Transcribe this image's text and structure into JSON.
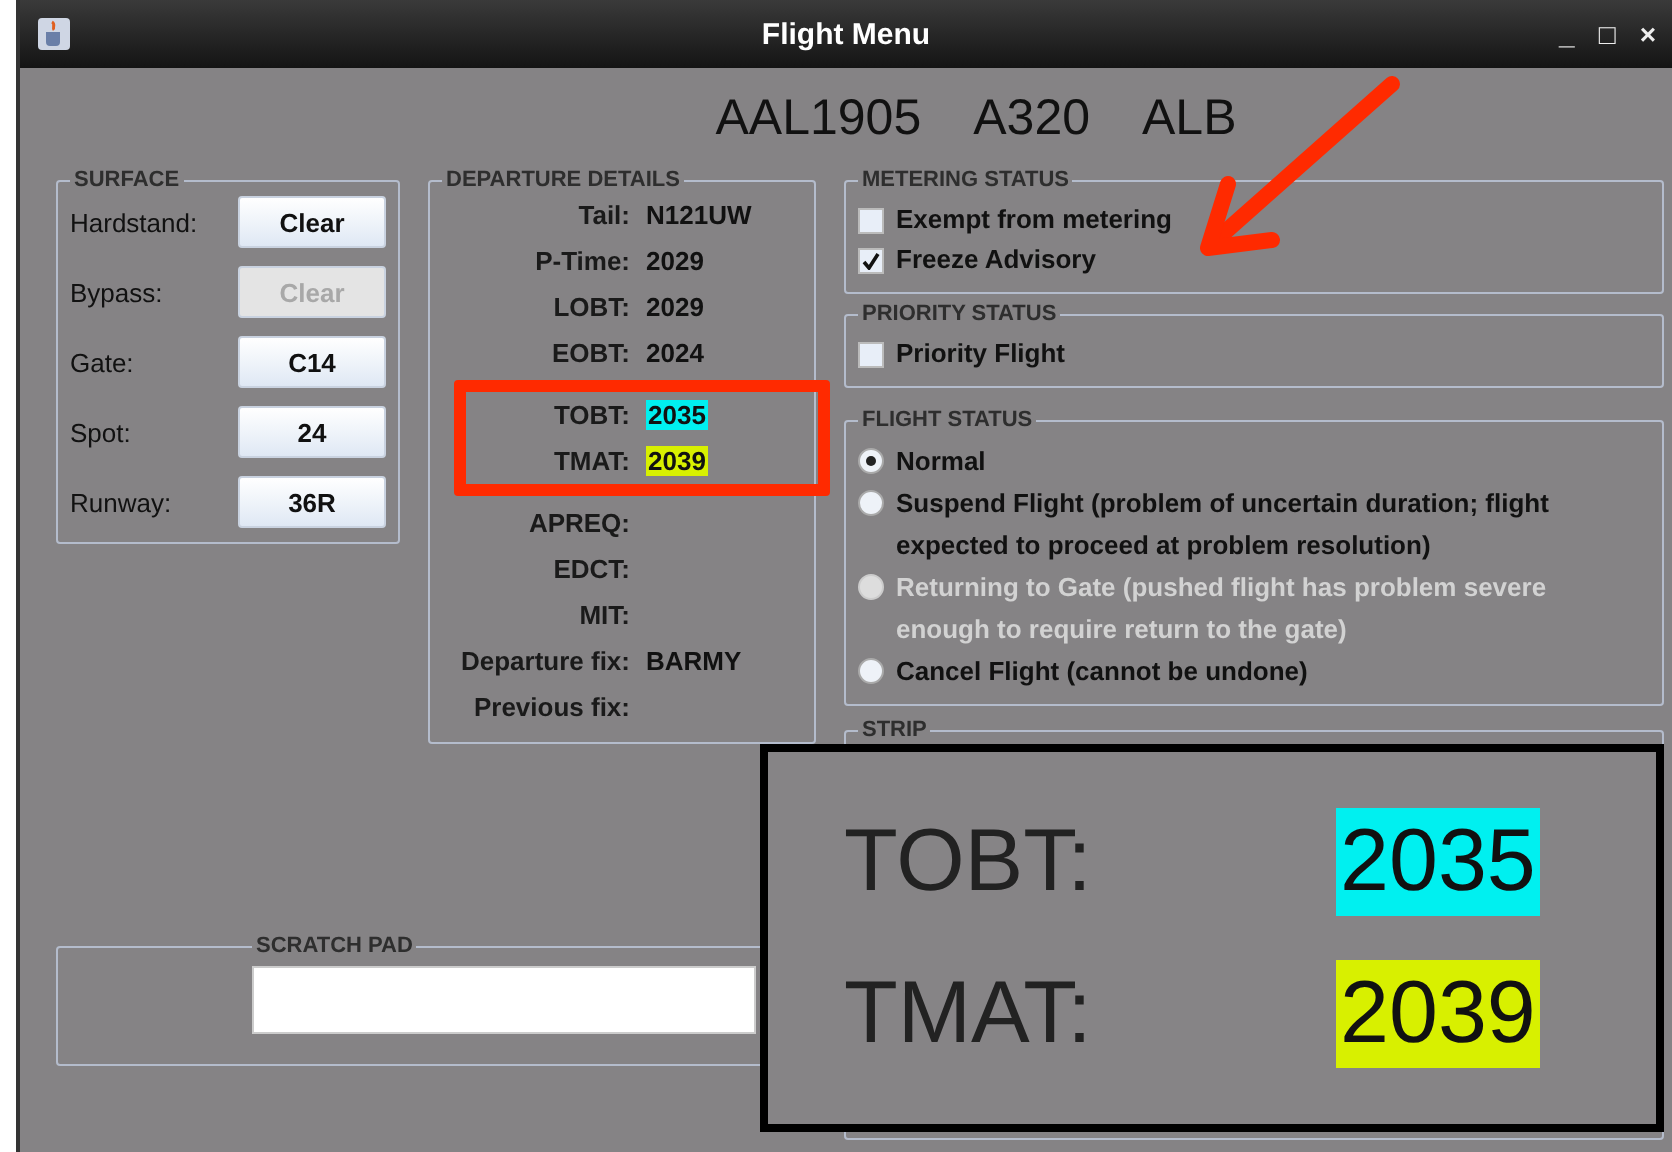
{
  "window": {
    "title": "Flight Menu",
    "controls": [
      "_",
      "□",
      "×"
    ]
  },
  "header": {
    "callsign": "AAL1905",
    "aircraft": "A320",
    "destination": "ALB"
  },
  "surface": {
    "title": "SURFACE",
    "rows": [
      {
        "label": "Hardstand:",
        "button": "Clear",
        "disabled": false
      },
      {
        "label": "Bypass:",
        "button": "Clear",
        "disabled": true
      },
      {
        "label": "Gate:",
        "button": "C14",
        "disabled": false
      },
      {
        "label": "Spot:",
        "button": "24",
        "disabled": false
      },
      {
        "label": "Runway:",
        "button": "36R",
        "disabled": false
      }
    ]
  },
  "departure_details": {
    "title": "DEPARTURE DETAILS",
    "rows": [
      {
        "label": "Tail:",
        "value": "N121UW"
      },
      {
        "label": "P-Time:",
        "value": "2029"
      },
      {
        "label": "LOBT:",
        "value": "2029"
      },
      {
        "label": "EOBT:",
        "value": "2024"
      },
      {
        "label": "TOBT:",
        "value": "2035",
        "color": "#00f0f0"
      },
      {
        "label": "TMAT:",
        "value": "2039",
        "color": "#d8f000"
      },
      {
        "label": "APREQ:"
      },
      {
        "label": "EDCT:"
      },
      {
        "label": "MIT:"
      },
      {
        "label": "Departure fix:",
        "value": "BARMY"
      },
      {
        "label": "Previous fix:"
      }
    ]
  },
  "metering_status": {
    "title": "METERING STATUS",
    "items": [
      {
        "label": "Exempt from metering",
        "checked": false
      },
      {
        "label": "Freeze Advisory",
        "checked": true
      }
    ]
  },
  "priority_status": {
    "title": "PRIORITY STATUS",
    "items": [
      {
        "label": "Priority Flight",
        "checked": false
      }
    ]
  },
  "flight_status": {
    "title": "FLIGHT STATUS",
    "options": [
      {
        "label": "Normal",
        "selected": true,
        "disabled": false
      },
      {
        "label": "Suspend Flight (problem of uncertain duration; flight expected to proceed at problem resolution)",
        "selected": false,
        "disabled": false
      },
      {
        "label": "Returning to Gate (pushed flight has problem severe enough to require return to the gate)",
        "selected": false,
        "disabled": true
      },
      {
        "label": "Cancel Flight (cannot be undone)",
        "selected": false,
        "disabled": false
      }
    ]
  },
  "strip": {
    "title": "STRIP"
  },
  "scratch_pad": {
    "title": "SCRATCH PAD"
  },
  "zoom_inset": {
    "rows": [
      {
        "label": "TOBT:",
        "value": "2035",
        "color": "#00f0f0"
      },
      {
        "label": "TMAT:",
        "value": "2039",
        "color": "#d8f000"
      }
    ]
  }
}
